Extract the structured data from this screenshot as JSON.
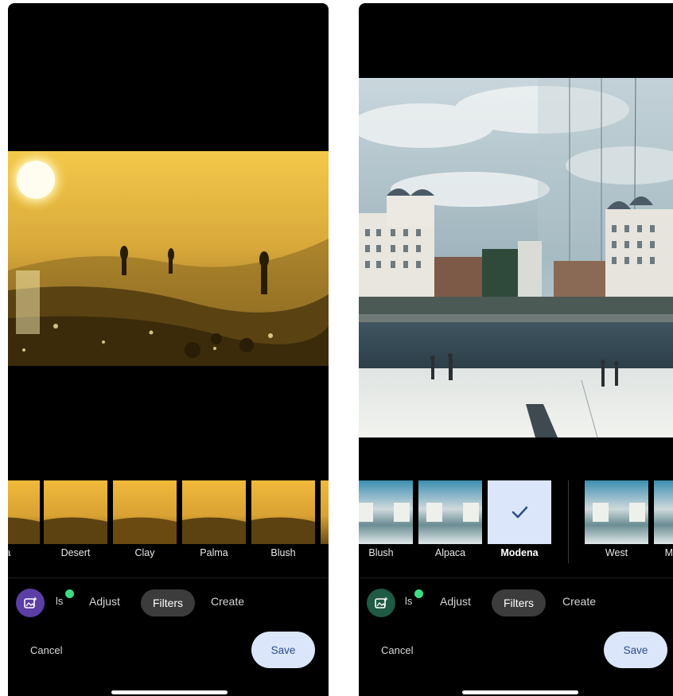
{
  "left_screen": {
    "filters": [
      {
        "label": "a",
        "selected": false
      },
      {
        "label": "Desert",
        "selected": false
      },
      {
        "label": "Clay",
        "selected": false
      },
      {
        "label": "Palma",
        "selected": false
      },
      {
        "label": "Blush",
        "selected": false
      }
    ],
    "tabs": {
      "partial": "ls",
      "adjust": "Adjust",
      "filters": "Filters",
      "create": "Create"
    },
    "cancel_label": "Cancel",
    "save_label": "Save",
    "badge_color": "#5b3ea6"
  },
  "right_screen": {
    "filters": [
      {
        "label": "Blush",
        "selected": false
      },
      {
        "label": "Alpaca",
        "selected": false
      },
      {
        "label": "Modena",
        "selected": true
      },
      {
        "label": "West",
        "selected": false
      },
      {
        "label": "M",
        "selected": false
      }
    ],
    "tabs": {
      "partial": "ls",
      "adjust": "Adjust",
      "filters": "Filters",
      "create": "Create"
    },
    "cancel_label": "Cancel",
    "save_label": "Save",
    "badge_color": "#1f5a44",
    "selected_icon": "checkmark-icon"
  },
  "colors": {
    "accent_pill": "#dbe6fb",
    "notification_dot": "#3ddc84",
    "active_tab_pill": "#3c3c3c"
  }
}
